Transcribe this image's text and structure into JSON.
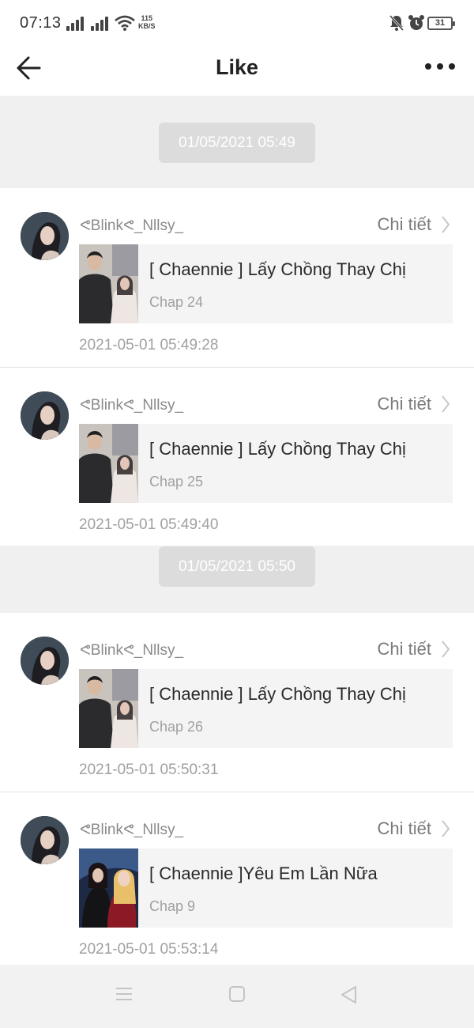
{
  "status_bar": {
    "time": "07:13",
    "net_speed_value": "115",
    "net_speed_unit": "KB/S",
    "battery": "31",
    "icons": [
      "signal-icon",
      "signal-icon",
      "wifi-icon",
      "mute-notification-icon",
      "alarm-icon",
      "battery-icon"
    ]
  },
  "header": {
    "title": "Like",
    "back_icon": "arrow-left-icon",
    "more_icon": "more-dots-icon"
  },
  "groups": [
    {
      "date": "01/05/2021 05:49",
      "items": [
        {
          "user": "ᕙBlinkᕙ_Nllsy_",
          "detail_label": "Chi tiết",
          "story_title": "[ Chaennie ] Lấy Chồng Thay Chị",
          "chapter": "Chap 24",
          "timestamp": "2021-05-01 05:49:28"
        },
        {
          "user": "ᕙBlinkᕙ_Nllsy_",
          "detail_label": "Chi tiết",
          "story_title": "[ Chaennie ] Lấy Chồng Thay Chị",
          "chapter": "Chap 25",
          "timestamp": "2021-05-01 05:49:40"
        }
      ]
    },
    {
      "date": "01/05/2021 05:50",
      "items": [
        {
          "user": "ᕙBlinkᕙ_Nllsy_",
          "detail_label": "Chi tiết",
          "story_title": "[ Chaennie ] Lấy Chồng Thay Chị",
          "chapter": "Chap 26",
          "timestamp": "2021-05-01 05:50:31"
        },
        {
          "user": "ᕙBlinkᕙ_Nllsy_",
          "detail_label": "Chi tiết",
          "story_title": "[ Chaennie ]Yêu Em Lần Nữa",
          "chapter": "Chap 9",
          "timestamp": "2021-05-01 05:53:14"
        }
      ]
    }
  ],
  "nav_bar": {
    "icons": [
      "menu-icon",
      "home-square-icon",
      "back-triangle-icon"
    ]
  },
  "colors": {
    "background": "#f0f0f0",
    "card": "#ffffff",
    "date_pill": "#dcdcdc",
    "muted_text": "#a0a0a0"
  }
}
